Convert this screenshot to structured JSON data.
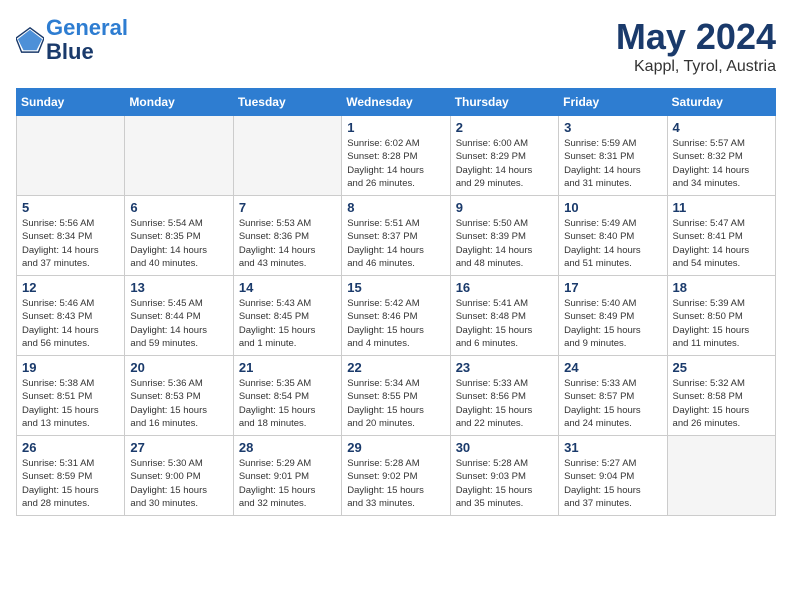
{
  "header": {
    "logo_line1": "General",
    "logo_line2": "Blue",
    "month": "May 2024",
    "location": "Kappl, Tyrol, Austria"
  },
  "days_of_week": [
    "Sunday",
    "Monday",
    "Tuesday",
    "Wednesday",
    "Thursday",
    "Friday",
    "Saturday"
  ],
  "weeks": [
    [
      {
        "day": "",
        "content": ""
      },
      {
        "day": "",
        "content": ""
      },
      {
        "day": "",
        "content": ""
      },
      {
        "day": "1",
        "content": "Sunrise: 6:02 AM\nSunset: 8:28 PM\nDaylight: 14 hours\nand 26 minutes."
      },
      {
        "day": "2",
        "content": "Sunrise: 6:00 AM\nSunset: 8:29 PM\nDaylight: 14 hours\nand 29 minutes."
      },
      {
        "day": "3",
        "content": "Sunrise: 5:59 AM\nSunset: 8:31 PM\nDaylight: 14 hours\nand 31 minutes."
      },
      {
        "day": "4",
        "content": "Sunrise: 5:57 AM\nSunset: 8:32 PM\nDaylight: 14 hours\nand 34 minutes."
      }
    ],
    [
      {
        "day": "5",
        "content": "Sunrise: 5:56 AM\nSunset: 8:34 PM\nDaylight: 14 hours\nand 37 minutes."
      },
      {
        "day": "6",
        "content": "Sunrise: 5:54 AM\nSunset: 8:35 PM\nDaylight: 14 hours\nand 40 minutes."
      },
      {
        "day": "7",
        "content": "Sunrise: 5:53 AM\nSunset: 8:36 PM\nDaylight: 14 hours\nand 43 minutes."
      },
      {
        "day": "8",
        "content": "Sunrise: 5:51 AM\nSunset: 8:37 PM\nDaylight: 14 hours\nand 46 minutes."
      },
      {
        "day": "9",
        "content": "Sunrise: 5:50 AM\nSunset: 8:39 PM\nDaylight: 14 hours\nand 48 minutes."
      },
      {
        "day": "10",
        "content": "Sunrise: 5:49 AM\nSunset: 8:40 PM\nDaylight: 14 hours\nand 51 minutes."
      },
      {
        "day": "11",
        "content": "Sunrise: 5:47 AM\nSunset: 8:41 PM\nDaylight: 14 hours\nand 54 minutes."
      }
    ],
    [
      {
        "day": "12",
        "content": "Sunrise: 5:46 AM\nSunset: 8:43 PM\nDaylight: 14 hours\nand 56 minutes."
      },
      {
        "day": "13",
        "content": "Sunrise: 5:45 AM\nSunset: 8:44 PM\nDaylight: 14 hours\nand 59 minutes."
      },
      {
        "day": "14",
        "content": "Sunrise: 5:43 AM\nSunset: 8:45 PM\nDaylight: 15 hours\nand 1 minute."
      },
      {
        "day": "15",
        "content": "Sunrise: 5:42 AM\nSunset: 8:46 PM\nDaylight: 15 hours\nand 4 minutes."
      },
      {
        "day": "16",
        "content": "Sunrise: 5:41 AM\nSunset: 8:48 PM\nDaylight: 15 hours\nand 6 minutes."
      },
      {
        "day": "17",
        "content": "Sunrise: 5:40 AM\nSunset: 8:49 PM\nDaylight: 15 hours\nand 9 minutes."
      },
      {
        "day": "18",
        "content": "Sunrise: 5:39 AM\nSunset: 8:50 PM\nDaylight: 15 hours\nand 11 minutes."
      }
    ],
    [
      {
        "day": "19",
        "content": "Sunrise: 5:38 AM\nSunset: 8:51 PM\nDaylight: 15 hours\nand 13 minutes."
      },
      {
        "day": "20",
        "content": "Sunrise: 5:36 AM\nSunset: 8:53 PM\nDaylight: 15 hours\nand 16 minutes."
      },
      {
        "day": "21",
        "content": "Sunrise: 5:35 AM\nSunset: 8:54 PM\nDaylight: 15 hours\nand 18 minutes."
      },
      {
        "day": "22",
        "content": "Sunrise: 5:34 AM\nSunset: 8:55 PM\nDaylight: 15 hours\nand 20 minutes."
      },
      {
        "day": "23",
        "content": "Sunrise: 5:33 AM\nSunset: 8:56 PM\nDaylight: 15 hours\nand 22 minutes."
      },
      {
        "day": "24",
        "content": "Sunrise: 5:33 AM\nSunset: 8:57 PM\nDaylight: 15 hours\nand 24 minutes."
      },
      {
        "day": "25",
        "content": "Sunrise: 5:32 AM\nSunset: 8:58 PM\nDaylight: 15 hours\nand 26 minutes."
      }
    ],
    [
      {
        "day": "26",
        "content": "Sunrise: 5:31 AM\nSunset: 8:59 PM\nDaylight: 15 hours\nand 28 minutes."
      },
      {
        "day": "27",
        "content": "Sunrise: 5:30 AM\nSunset: 9:00 PM\nDaylight: 15 hours\nand 30 minutes."
      },
      {
        "day": "28",
        "content": "Sunrise: 5:29 AM\nSunset: 9:01 PM\nDaylight: 15 hours\nand 32 minutes."
      },
      {
        "day": "29",
        "content": "Sunrise: 5:28 AM\nSunset: 9:02 PM\nDaylight: 15 hours\nand 33 minutes."
      },
      {
        "day": "30",
        "content": "Sunrise: 5:28 AM\nSunset: 9:03 PM\nDaylight: 15 hours\nand 35 minutes."
      },
      {
        "day": "31",
        "content": "Sunrise: 5:27 AM\nSunset: 9:04 PM\nDaylight: 15 hours\nand 37 minutes."
      },
      {
        "day": "",
        "content": ""
      }
    ]
  ]
}
